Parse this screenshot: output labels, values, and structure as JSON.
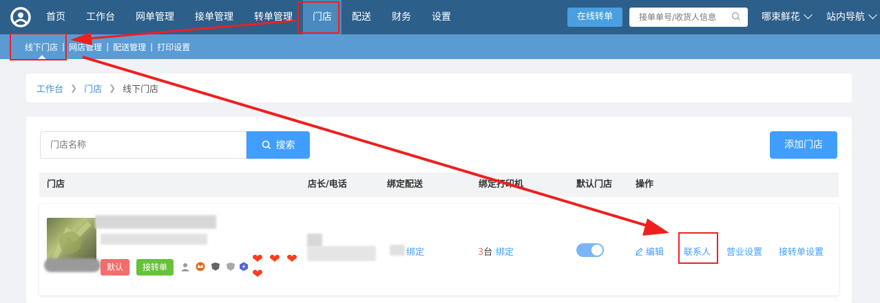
{
  "nav": {
    "items": [
      "首页",
      "工作台",
      "网单管理",
      "接单管理",
      "转单管理",
      "门店",
      "配送",
      "财务",
      "设置"
    ],
    "active": "门店",
    "online_transfer": "在线转单",
    "search_placeholder": "接单单号/收货人信息",
    "store_name": "哪束鲜花",
    "site_nav": "站内导航"
  },
  "subnav": {
    "items": [
      "线下门店",
      "网店管理",
      "配送管理",
      "打印设置"
    ],
    "separator": "|"
  },
  "breadcrumb": {
    "items": [
      "工作台",
      "门店",
      "线下门店"
    ]
  },
  "toolbar": {
    "store_placeholder": "门店名称",
    "search_label": "搜索",
    "add_label": "添加门店"
  },
  "table": {
    "headers": [
      "门店",
      "店长/电话",
      "绑定配送",
      "绑定打印机",
      "默认门店",
      "操作"
    ],
    "row": {
      "tags": [
        "默认",
        "接转单"
      ],
      "delivery_action": "绑定",
      "printer_count": "3",
      "printer_unit": "台",
      "printer_action": "绑定",
      "is_default": true,
      "actions": [
        "编辑",
        "联系人",
        "营业设置",
        "接转单设置"
      ]
    }
  },
  "colors": {
    "nav_bg": "#2d5f8b",
    "nav_active": "#4a8ac0",
    "subnav_bg": "#5a9bd4",
    "primary": "#409eff",
    "tag_red": "#f56c6c",
    "tag_green": "#67c23a",
    "annotation": "#ee1f1f"
  }
}
